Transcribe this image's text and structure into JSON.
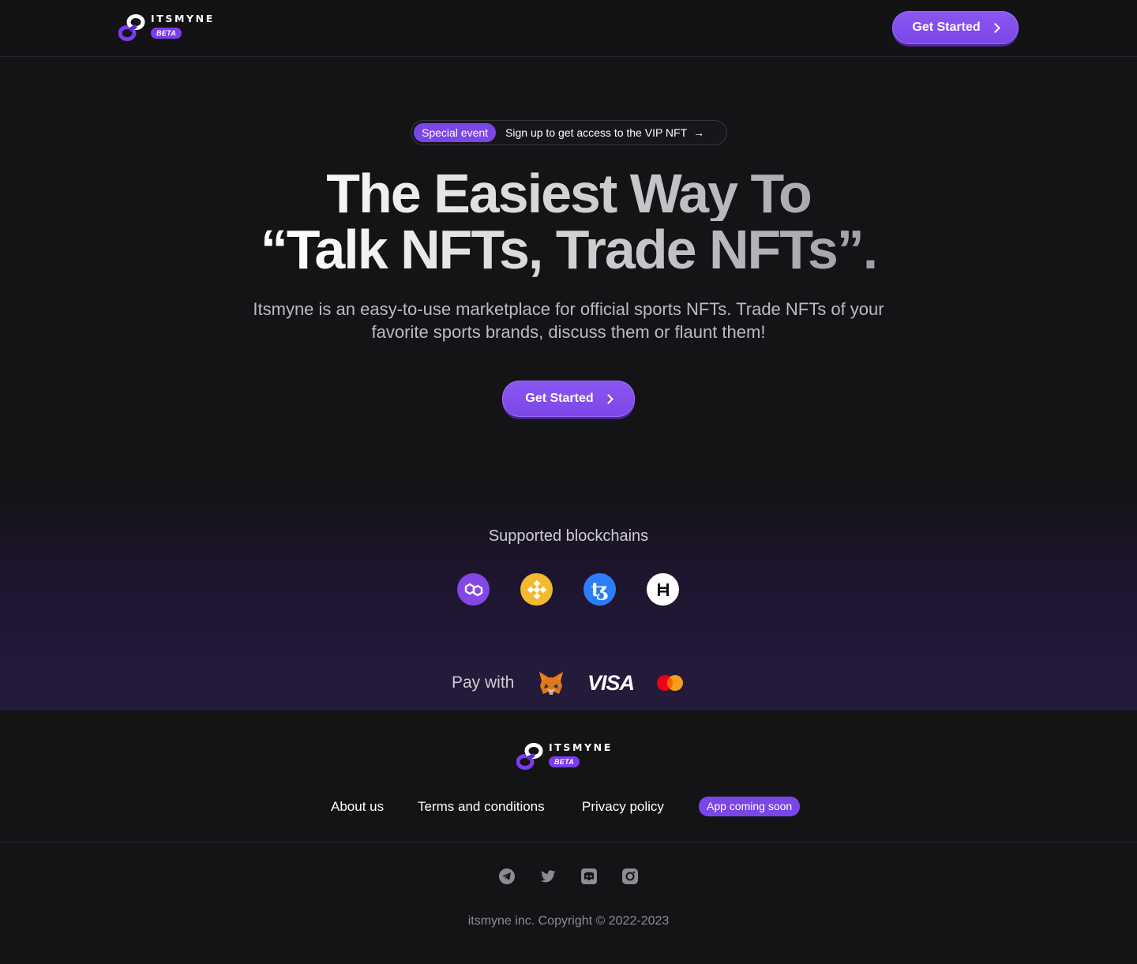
{
  "header": {
    "brand": "ITSMYNE",
    "badge": "BETA",
    "cta_label": "Get Started"
  },
  "hero": {
    "event_tag": "Special event",
    "event_text": "Sign up to get access to the VIP NFT",
    "headline_line1": "The Easiest Way To",
    "headline_line2": "“Talk NFTs, Trade NFTs”.",
    "subtext": "Itsmyne is an easy-to-use marketplace for official sports NFTs. Trade NFTs of your favorite sports brands, discuss them or flaunt them!",
    "cta_label": "Get Started"
  },
  "blockchains": {
    "title": "Supported blockchains",
    "items": [
      {
        "name": "polygon-icon",
        "color": "#8247e5"
      },
      {
        "name": "binance-icon",
        "color": "#f3ba2f"
      },
      {
        "name": "tezos-icon",
        "color": "#2c7df7"
      },
      {
        "name": "hedera-icon",
        "color": "#ffffff"
      }
    ]
  },
  "payments": {
    "label": "Pay with",
    "visa": "VISA",
    "methods": [
      "metamask-icon",
      "visa-logo",
      "mastercard-icon"
    ]
  },
  "footer": {
    "brand": "ITSMYNE",
    "badge": "BETA",
    "links": [
      "About us",
      "Terms and conditions",
      "Privacy policy"
    ],
    "app_badge": "App coming soon",
    "social": [
      "telegram-icon",
      "twitter-icon",
      "discord-icon",
      "instagram-icon"
    ],
    "copyright": "itsmyne inc. Copyright © 2022-2023"
  },
  "colors": {
    "accent": "#7a46e8",
    "background": "#141316",
    "pay_strip": "#241a3a"
  }
}
